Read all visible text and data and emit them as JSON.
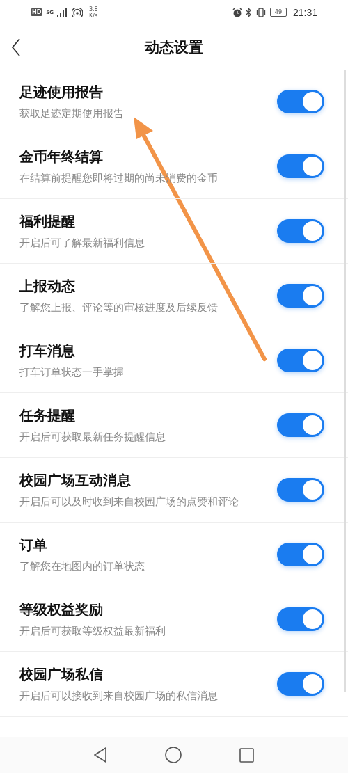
{
  "status_bar": {
    "hd": "HD",
    "network": "5G",
    "speed_value": "3.8",
    "speed_unit": "K/s",
    "battery": "49",
    "time": "21:31"
  },
  "header": {
    "title": "动态设置"
  },
  "settings": [
    {
      "title": "足迹使用报告",
      "subtitle": "获取足迹定期使用报告",
      "on": true
    },
    {
      "title": "金币年终结算",
      "subtitle": "在结算前提醒您即将过期的尚未消费的金币",
      "on": true
    },
    {
      "title": "福利提醒",
      "subtitle": "开启后可了解最新福利信息",
      "on": true
    },
    {
      "title": "上报动态",
      "subtitle": "了解您上报、评论等的审核进度及后续反馈",
      "on": true
    },
    {
      "title": "打车消息",
      "subtitle": "打车订单状态一手掌握",
      "on": true
    },
    {
      "title": "任务提醒",
      "subtitle": "开启后可获取最新任务提醒信息",
      "on": true
    },
    {
      "title": "校园广场互动消息",
      "subtitle": "开启后可以及时收到来自校园广场的点赞和评论",
      "on": true
    },
    {
      "title": "订单",
      "subtitle": "了解您在地图内的订单状态",
      "on": true
    },
    {
      "title": "等级权益奖励",
      "subtitle": "开启后可获取等级权益最新福利",
      "on": true
    },
    {
      "title": "校园广场私信",
      "subtitle": "开启后可以接收到来自校园广场的私信消息",
      "on": true
    }
  ]
}
